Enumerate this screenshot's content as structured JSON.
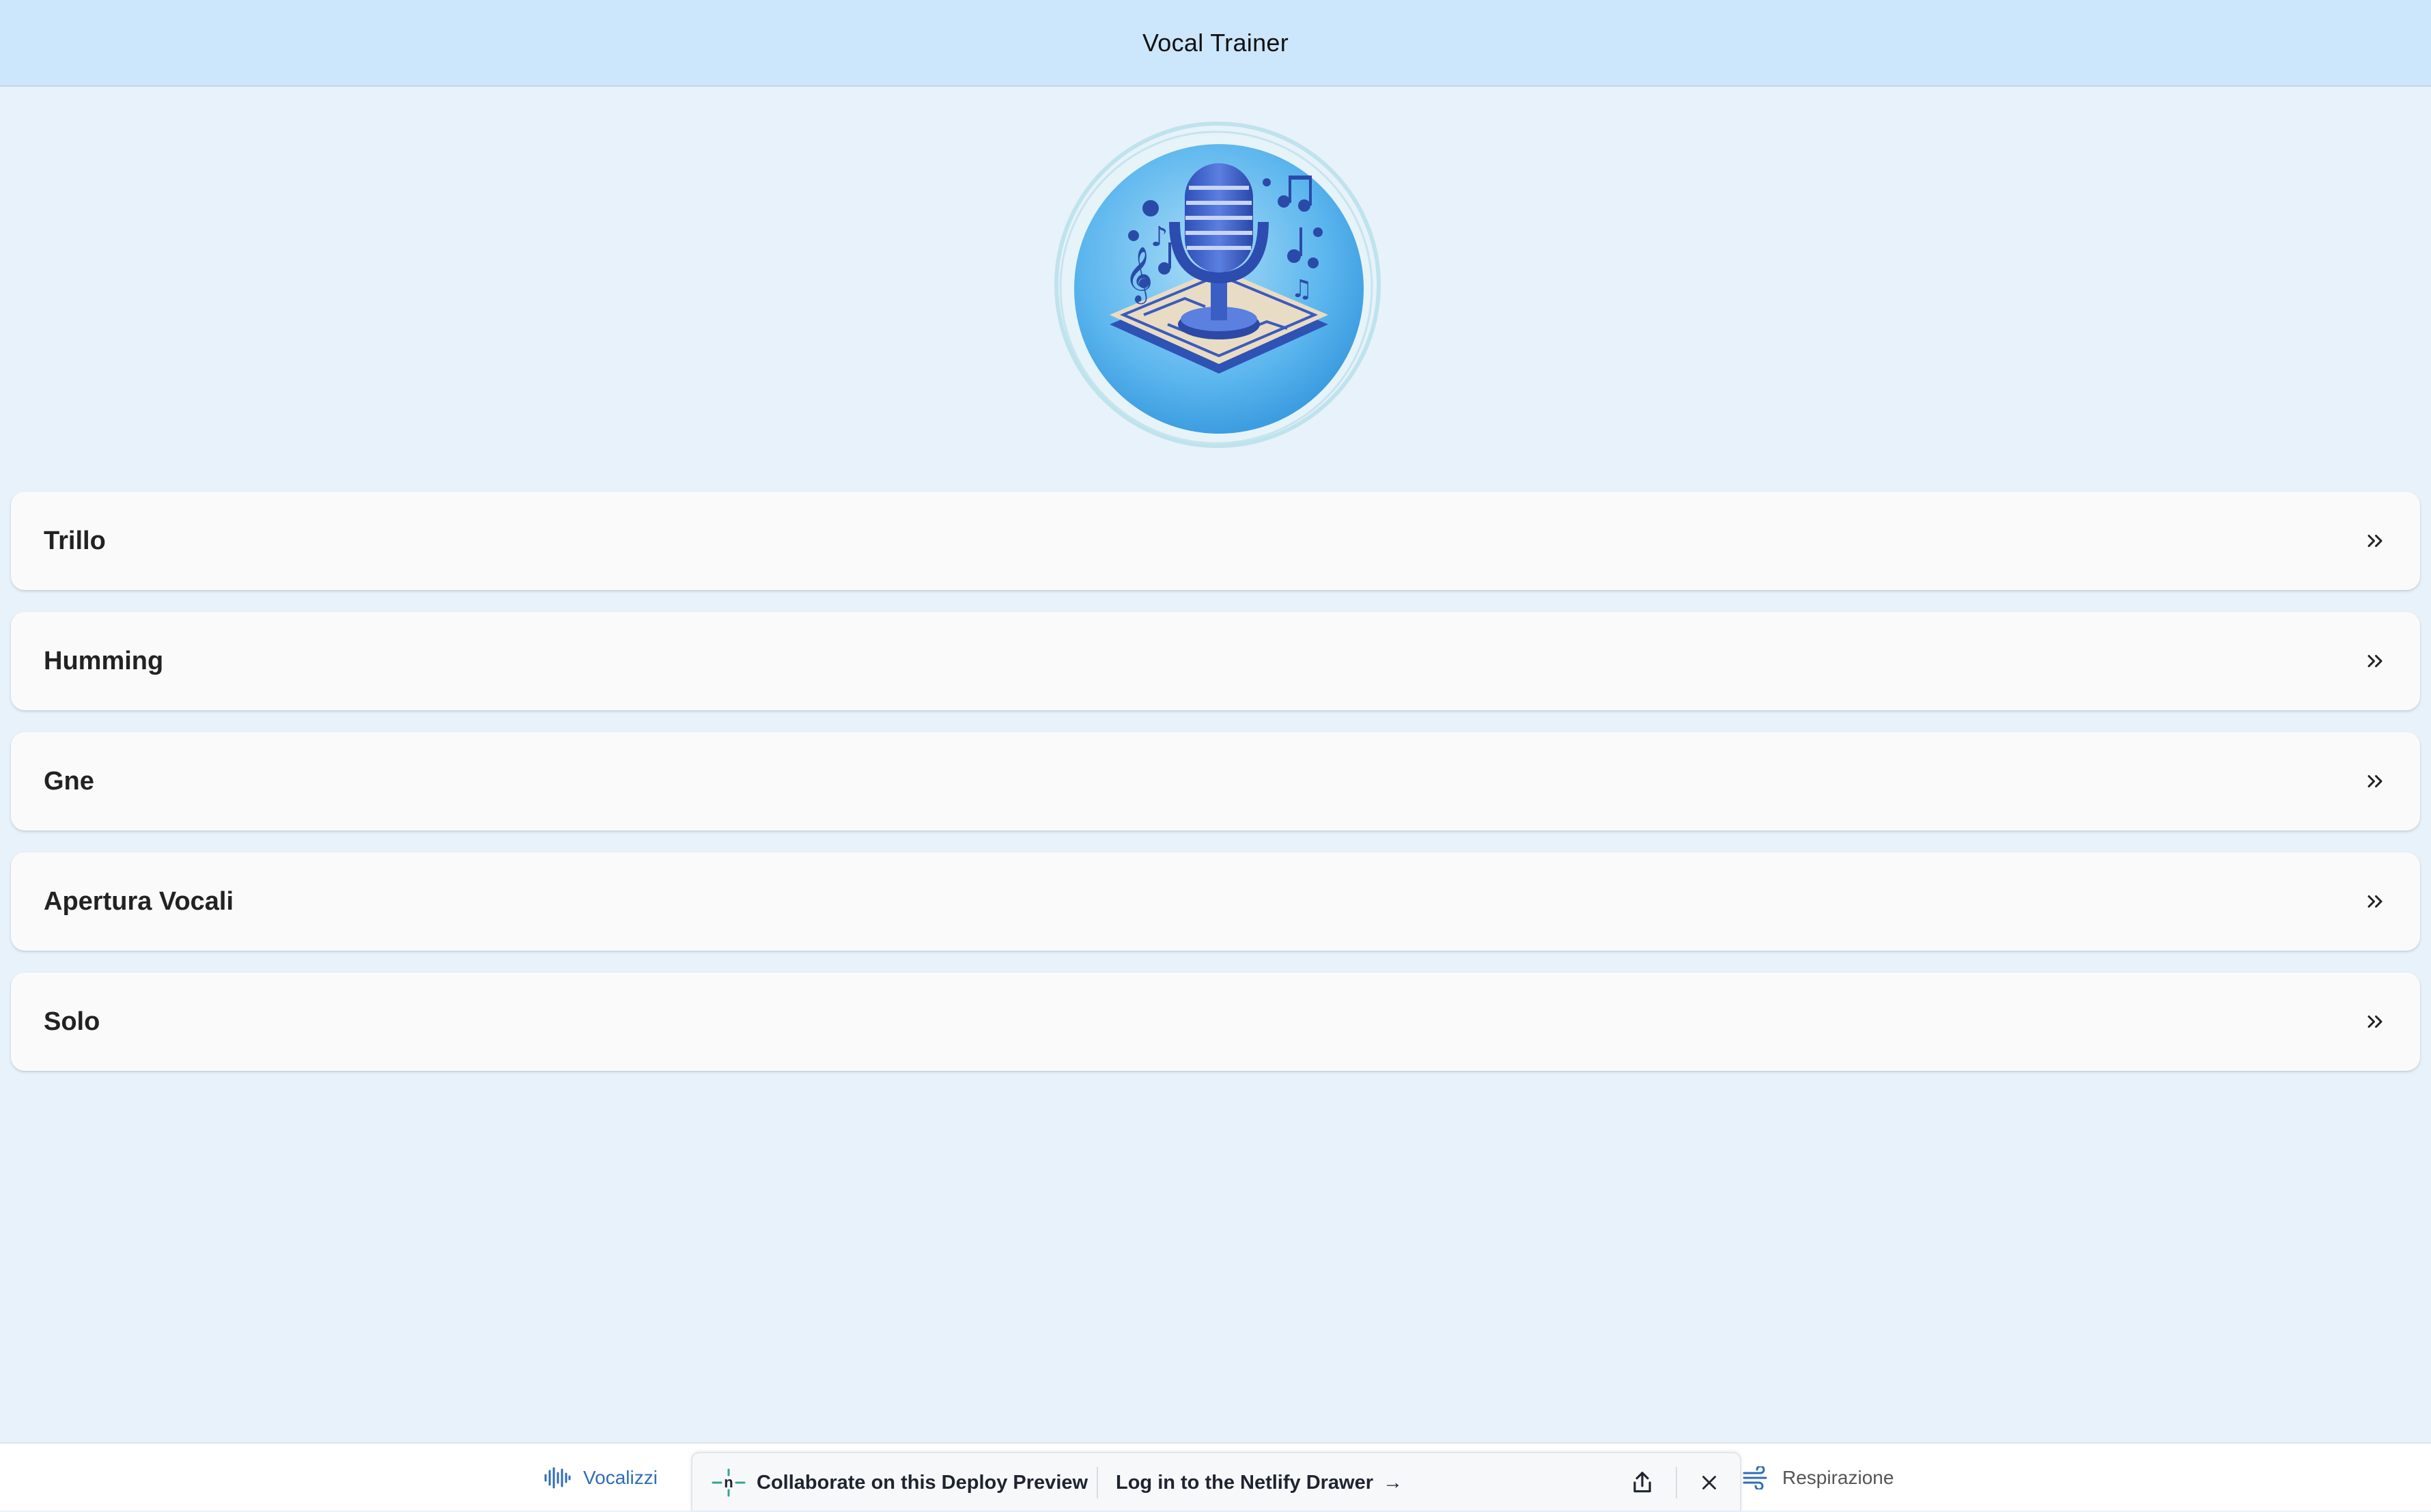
{
  "header": {
    "title": "Vocal Trainer"
  },
  "logo": {
    "icon": "microphone-music-logo"
  },
  "exercises": [
    {
      "label": "Trillo"
    },
    {
      "label": "Humming"
    },
    {
      "label": "Gne"
    },
    {
      "label": "Apertura Vocali"
    },
    {
      "label": "Solo"
    }
  ],
  "bottom_nav": {
    "vocalizzi": {
      "label": "Vocalizzi",
      "icon": "waveform-icon",
      "active": true
    },
    "respirazione": {
      "label": "Respirazione",
      "icon": "wind-icon",
      "active": false
    }
  },
  "netlify_drawer": {
    "collab_label": "Collaborate on this Deploy Preview",
    "login_label": "Log in to the Netlify Drawer",
    "login_arrow": "→"
  },
  "colors": {
    "background": "#e7f2fb",
    "header_bg": "#cce6fb",
    "accent": "#2f6db5",
    "netlify_teal": "#32a593"
  }
}
